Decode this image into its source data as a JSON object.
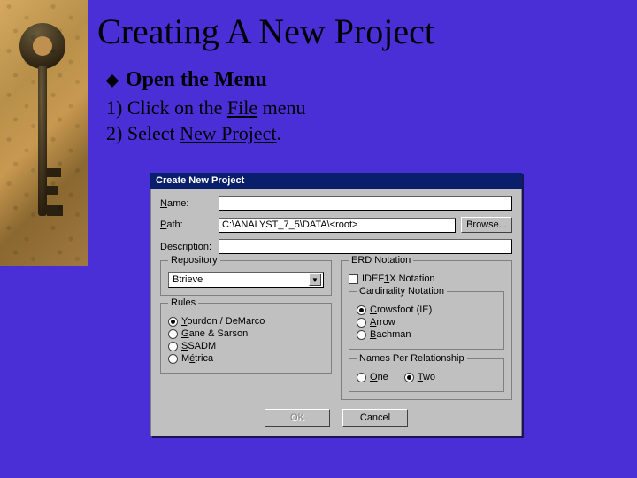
{
  "slide": {
    "title": "Creating A New Project",
    "subheading": "Open the Menu",
    "steps": [
      {
        "num": "1)",
        "pre": "Click on the ",
        "u": "File",
        "post": " menu"
      },
      {
        "num": "2)",
        "pre": "Select ",
        "u": "New Project",
        "post": "."
      }
    ]
  },
  "dialog": {
    "title": "Create New Project",
    "fields": {
      "name_label": "Name:",
      "name_value": "",
      "path_label": "Path:",
      "path_value": "C:\\ANALYST_7_5\\DATA\\<root>",
      "desc_label": "Description:",
      "desc_value": "",
      "browse": "Browse..."
    },
    "repository": {
      "legend": "Repository",
      "selected": "Btrieve"
    },
    "rules": {
      "legend": "Rules",
      "options": [
        {
          "label_pre": "",
          "u": "Y",
          "label_post": "ourdon / DeMarco",
          "selected": true
        },
        {
          "label_pre": "",
          "u": "G",
          "label_post": "ane & Sarson",
          "selected": false
        },
        {
          "label_pre": "",
          "u": "S",
          "label_post": "SADM",
          "selected": false
        },
        {
          "label_pre": "M",
          "u": "é",
          "label_post": "trica",
          "selected": false
        }
      ]
    },
    "erd": {
      "legend": "ERD Notation",
      "idef": {
        "label": "IDEF1X Notation",
        "u": "1",
        "checked": false
      },
      "cardinality": {
        "legend": "Cardinality Notation",
        "options": [
          {
            "u": "C",
            "label": "rowsfoot (IE)",
            "selected": true
          },
          {
            "u": "A",
            "label": "rrow",
            "selected": false
          },
          {
            "u": "B",
            "label": "achman",
            "selected": false
          }
        ]
      },
      "names": {
        "legend": "Names Per Relationship",
        "options": [
          {
            "u": "O",
            "label": "ne",
            "selected": false
          },
          {
            "u": "T",
            "label": "wo",
            "selected": true
          }
        ]
      }
    },
    "buttons": {
      "ok": "OK",
      "cancel": "Cancel"
    }
  }
}
